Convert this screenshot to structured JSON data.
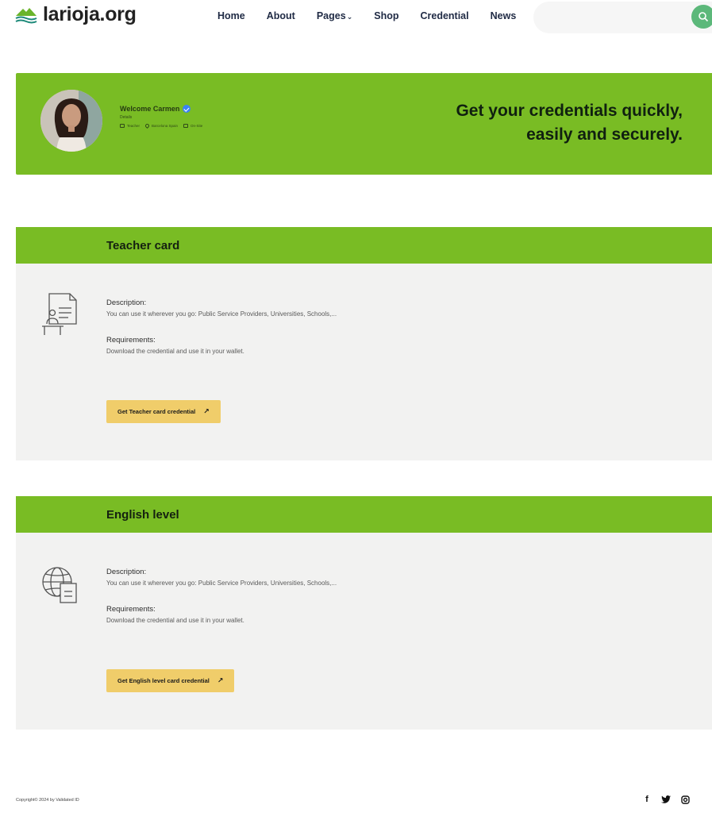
{
  "header": {
    "logo_text": "larioja.org",
    "nav": [
      {
        "label": "Home"
      },
      {
        "label": "About"
      },
      {
        "label": "Pages",
        "has_dropdown": true
      },
      {
        "label": "Shop"
      },
      {
        "label": "Credential"
      },
      {
        "label": "News"
      }
    ],
    "search_placeholder": ""
  },
  "banner": {
    "welcome": "Welcome Carmen",
    "details": "Details",
    "meta": [
      "Teacher",
      "Barcelona Spain",
      "On-Site"
    ],
    "tagline_line1": "Get your credentials quickly,",
    "tagline_line2": "easily and securely."
  },
  "cards": [
    {
      "title": "Teacher card",
      "icon": "teacher-board-icon",
      "description_label": "Description:",
      "description": "You can use it wherever you go: Public Service Providers, Universities, Schools,...",
      "requirements_label": "Requirements:",
      "requirements": "Download the credential and use it in your wallet.",
      "button": "Get Teacher card credential"
    },
    {
      "title": "English level",
      "icon": "globe-document-icon",
      "description_label": "Description:",
      "description": "You can use it wherever you go: Public Service Providers, Universities, Schools,...",
      "requirements_label": "Requirements:",
      "requirements": "Download the credential and use it in your wallet.",
      "button": "Get English level card credential"
    }
  ],
  "footer": {
    "copyright": "Copyright© 2024 by Validated ID",
    "socials": [
      "facebook-icon",
      "twitter-icon",
      "instagram-icon"
    ]
  },
  "colors": {
    "brand_green": "#79bc24",
    "button_yellow": "#f0cd6a",
    "search_green": "#5cb87a",
    "card_bg": "#f2f2f1"
  }
}
